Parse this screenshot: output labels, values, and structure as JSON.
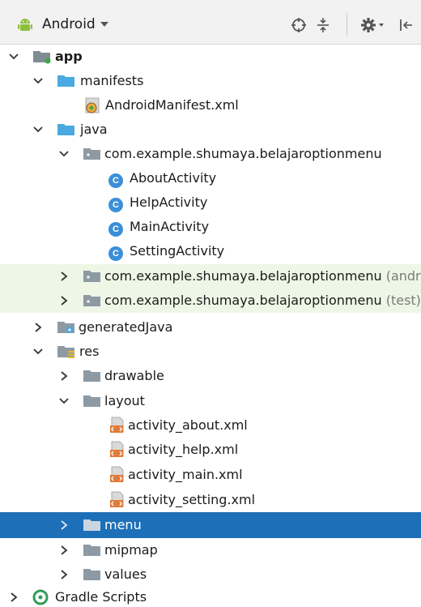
{
  "toolbar": {
    "view_title": "Android",
    "icons": [
      "android-icon",
      "chevron-down-icon",
      "target-icon",
      "collapse-icon",
      "gear-icon",
      "hide-panel-icon"
    ]
  },
  "colors": {
    "selection": "#1d6fb8",
    "test_highlight": "#eef7e6",
    "folder": "#4aa9e0",
    "class_badge": "#3b8fd8",
    "xml": "#e07b39",
    "gradle": "#2f9e57"
  },
  "tree": {
    "app": "app",
    "manifests": "manifests",
    "android_manifest": "AndroidManifest.xml",
    "java": "java",
    "pkg_main": "com.example.shumaya.belajaroptionmenu",
    "about_activity": "AboutActivity",
    "help_activity": "HelpActivity",
    "main_activity": "MainActivity",
    "setting_activity": "SettingActivity",
    "pkg_android_test": "com.example.shumaya.belajaroptionmenu",
    "pkg_android_test_suffix": "(andr",
    "pkg_test": "com.example.shumaya.belajaroptionmenu",
    "pkg_test_suffix": "(test)",
    "generated_java": "generatedJava",
    "res": "res",
    "drawable": "drawable",
    "layout": "layout",
    "activity_about": "activity_about.xml",
    "activity_help": "activity_help.xml",
    "activity_main": "activity_main.xml",
    "activity_setting": "activity_setting.xml",
    "menu": "menu",
    "mipmap": "mipmap",
    "values": "values",
    "gradle_scripts": "Gradle Scripts",
    "class_badge_letter": "C"
  }
}
